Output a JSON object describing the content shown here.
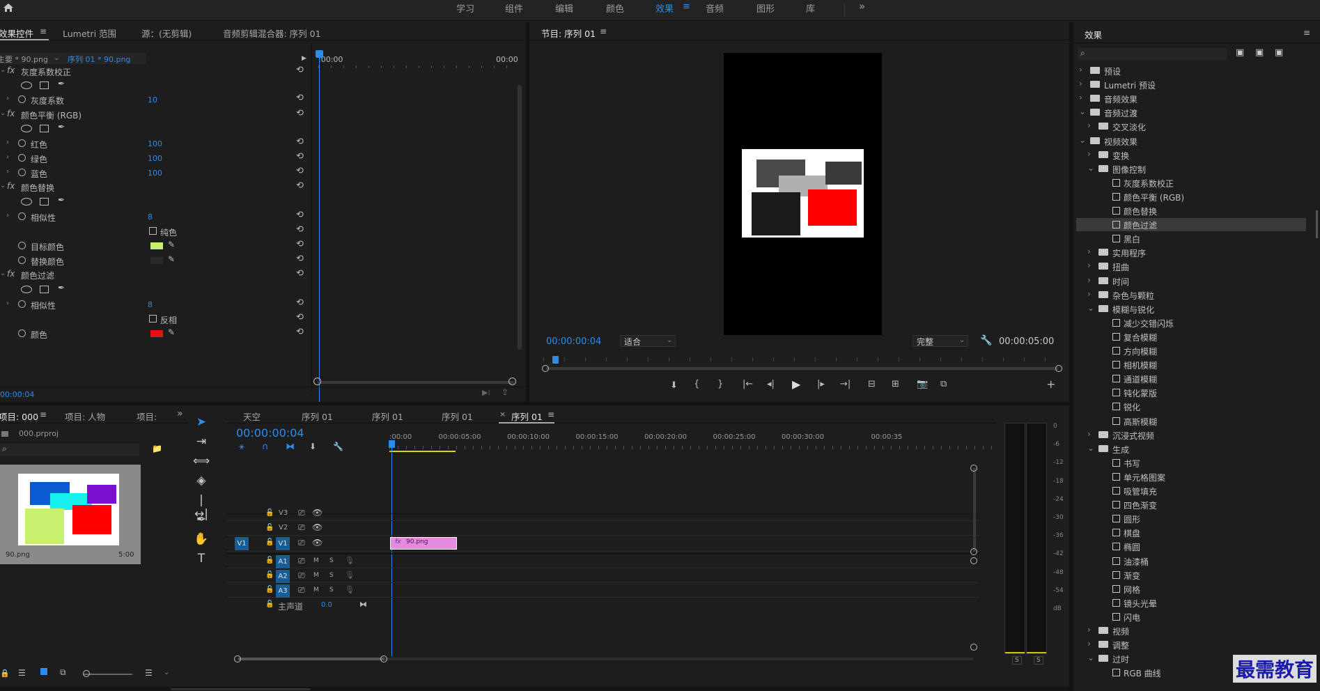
{
  "workspaces": [
    "学习",
    "组件",
    "编辑",
    "颜色",
    "效果",
    "音频",
    "图形",
    "库"
  ],
  "workspace_active_menu": "≡",
  "workspace_more": "»",
  "effect_controls": {
    "tabs": [
      "效果控件",
      "Lumetri 范围",
      "源：(无剪辑)",
      "音频剪辑混合器: 序列 01"
    ],
    "menu": "≡",
    "clip_master": "主要 * 90.png",
    "clip_seq": "序列 01 * 90.png",
    "tl_start": ":00:00",
    "tl_end": "00:00",
    "effects": [
      {
        "name": "灰度系数校正",
        "params": [
          {
            "label": "灰度系数",
            "value": "10"
          }
        ]
      },
      {
        "name": "颜色平衡 (RGB)",
        "params": [
          {
            "label": "红色",
            "value": "100"
          },
          {
            "label": "绿色",
            "value": "100"
          },
          {
            "label": "蓝色",
            "value": "100"
          }
        ]
      },
      {
        "name": "颜色替换",
        "params": [
          {
            "label": "相似性",
            "value": "8"
          },
          {
            "label": "纯色",
            "value": ""
          },
          {
            "label": "目标颜色",
            "value": ""
          },
          {
            "label": "替换颜色",
            "value": ""
          }
        ]
      },
      {
        "name": "颜色过滤",
        "params": [
          {
            "label": "相似性",
            "value": "8"
          },
          {
            "label": "反相",
            "value": ""
          },
          {
            "label": "颜色",
            "value": ""
          }
        ]
      }
    ],
    "fx_label": "fx",
    "timecode": "00:00:04",
    "target_color": "#c8f06e",
    "replace_color": "#2a2a2a",
    "filter_color": "#e81010"
  },
  "program": {
    "title": "节目: 序列 01",
    "menu": "≡",
    "timecode": "00:00:00:04",
    "fit": "适合",
    "quality": "完整",
    "duration": "00:00:05:00"
  },
  "effects_panel": {
    "title": "效果",
    "menu": "≡",
    "items": [
      {
        "label": "预设",
        "type": "folder",
        "level": 0,
        "open": false
      },
      {
        "label": "Lumetri 预设",
        "type": "folder",
        "level": 0,
        "open": false
      },
      {
        "label": "音频效果",
        "type": "folder",
        "level": 0,
        "open": false
      },
      {
        "label": "音频过渡",
        "type": "folder",
        "level": 0,
        "open": true
      },
      {
        "label": "交叉淡化",
        "type": "folder",
        "level": 1,
        "open": false
      },
      {
        "label": "视频效果",
        "type": "folder",
        "level": 0,
        "open": true
      },
      {
        "label": "变换",
        "type": "folder",
        "level": 1,
        "open": false
      },
      {
        "label": "图像控制",
        "type": "folder",
        "level": 1,
        "open": true
      },
      {
        "label": "灰度系数校正",
        "type": "preset",
        "level": 2
      },
      {
        "label": "颜色平衡 (RGB)",
        "type": "preset",
        "level": 2
      },
      {
        "label": "颜色替换",
        "type": "preset",
        "level": 2
      },
      {
        "label": "颜色过滤",
        "type": "preset",
        "level": 2,
        "selected": true
      },
      {
        "label": "黑白",
        "type": "preset",
        "level": 2
      },
      {
        "label": "实用程序",
        "type": "folder",
        "level": 1,
        "open": false
      },
      {
        "label": "扭曲",
        "type": "folder",
        "level": 1,
        "open": false
      },
      {
        "label": "时间",
        "type": "folder",
        "level": 1,
        "open": false
      },
      {
        "label": "杂色与颗粒",
        "type": "folder",
        "level": 1,
        "open": false
      },
      {
        "label": "模糊与锐化",
        "type": "folder",
        "level": 1,
        "open": true
      },
      {
        "label": "减少交错闪烁",
        "type": "preset",
        "level": 2
      },
      {
        "label": "复合模糊",
        "type": "preset",
        "level": 2
      },
      {
        "label": "方向模糊",
        "type": "preset",
        "level": 2
      },
      {
        "label": "相机模糊",
        "type": "preset",
        "level": 2
      },
      {
        "label": "通道模糊",
        "type": "preset",
        "level": 2
      },
      {
        "label": "钝化蒙版",
        "type": "preset",
        "level": 2
      },
      {
        "label": "锐化",
        "type": "preset",
        "level": 2
      },
      {
        "label": "高斯模糊",
        "type": "preset",
        "level": 2
      },
      {
        "label": "沉浸式视频",
        "type": "folder",
        "level": 1,
        "open": false
      },
      {
        "label": "生成",
        "type": "folder",
        "level": 1,
        "open": true
      },
      {
        "label": "书写",
        "type": "preset",
        "level": 2
      },
      {
        "label": "单元格图案",
        "type": "preset",
        "level": 2
      },
      {
        "label": "吸管填充",
        "type": "preset",
        "level": 2
      },
      {
        "label": "四色渐变",
        "type": "preset",
        "level": 2
      },
      {
        "label": "圆形",
        "type": "preset",
        "level": 2
      },
      {
        "label": "棋盘",
        "type": "preset",
        "level": 2
      },
      {
        "label": "椭圆",
        "type": "preset",
        "level": 2
      },
      {
        "label": "油漆桶",
        "type": "preset",
        "level": 2
      },
      {
        "label": "渐变",
        "type": "preset",
        "level": 2
      },
      {
        "label": "网格",
        "type": "preset",
        "level": 2
      },
      {
        "label": "镜头光晕",
        "type": "preset",
        "level": 2
      },
      {
        "label": "闪电",
        "type": "preset",
        "level": 2
      },
      {
        "label": "视频",
        "type": "folder",
        "level": 1,
        "open": false
      },
      {
        "label": "调整",
        "type": "folder",
        "level": 1,
        "open": false
      },
      {
        "label": "过时",
        "type": "folder",
        "level": 1,
        "open": true
      },
      {
        "label": "RGB 曲线",
        "type": "preset",
        "level": 2
      }
    ]
  },
  "project": {
    "tabs": [
      "项目: 000",
      "项目: 人物",
      "项目:"
    ],
    "menu": "≡",
    "more": "»",
    "file": "000.prproj",
    "thumb_name": "90.png",
    "thumb_dur": "5:00"
  },
  "timeline": {
    "tabs": [
      "天空",
      "序列 01",
      "序列 01",
      "序列 01",
      "序列 01"
    ],
    "close": "×",
    "menu": "≡",
    "timecode": "00:00:00:04",
    "ruler": [
      ":00:00",
      "00:00:05:00",
      "00:00:10:00",
      "00:00:15:00",
      "00:00:20:00",
      "00:00:25:00",
      "00:00:30:00",
      "00:00:35"
    ],
    "video_tracks": [
      "V3",
      "V2",
      "V1"
    ],
    "source_v": "V1",
    "audio_tracks": [
      "A1",
      "A2",
      "A3"
    ],
    "m": "M",
    "s": "S",
    "master_label": "主声道",
    "master_value": "0.0",
    "clip_label": "90.png",
    "clip_fx": "fx"
  },
  "meter": {
    "scale": [
      "0",
      "-6",
      "-12",
      "-18",
      "-24",
      "-30",
      "-36",
      "-42",
      "-48",
      "-54",
      "dB"
    ],
    "solo": [
      "S",
      "S"
    ]
  },
  "watermark": "最需教育"
}
